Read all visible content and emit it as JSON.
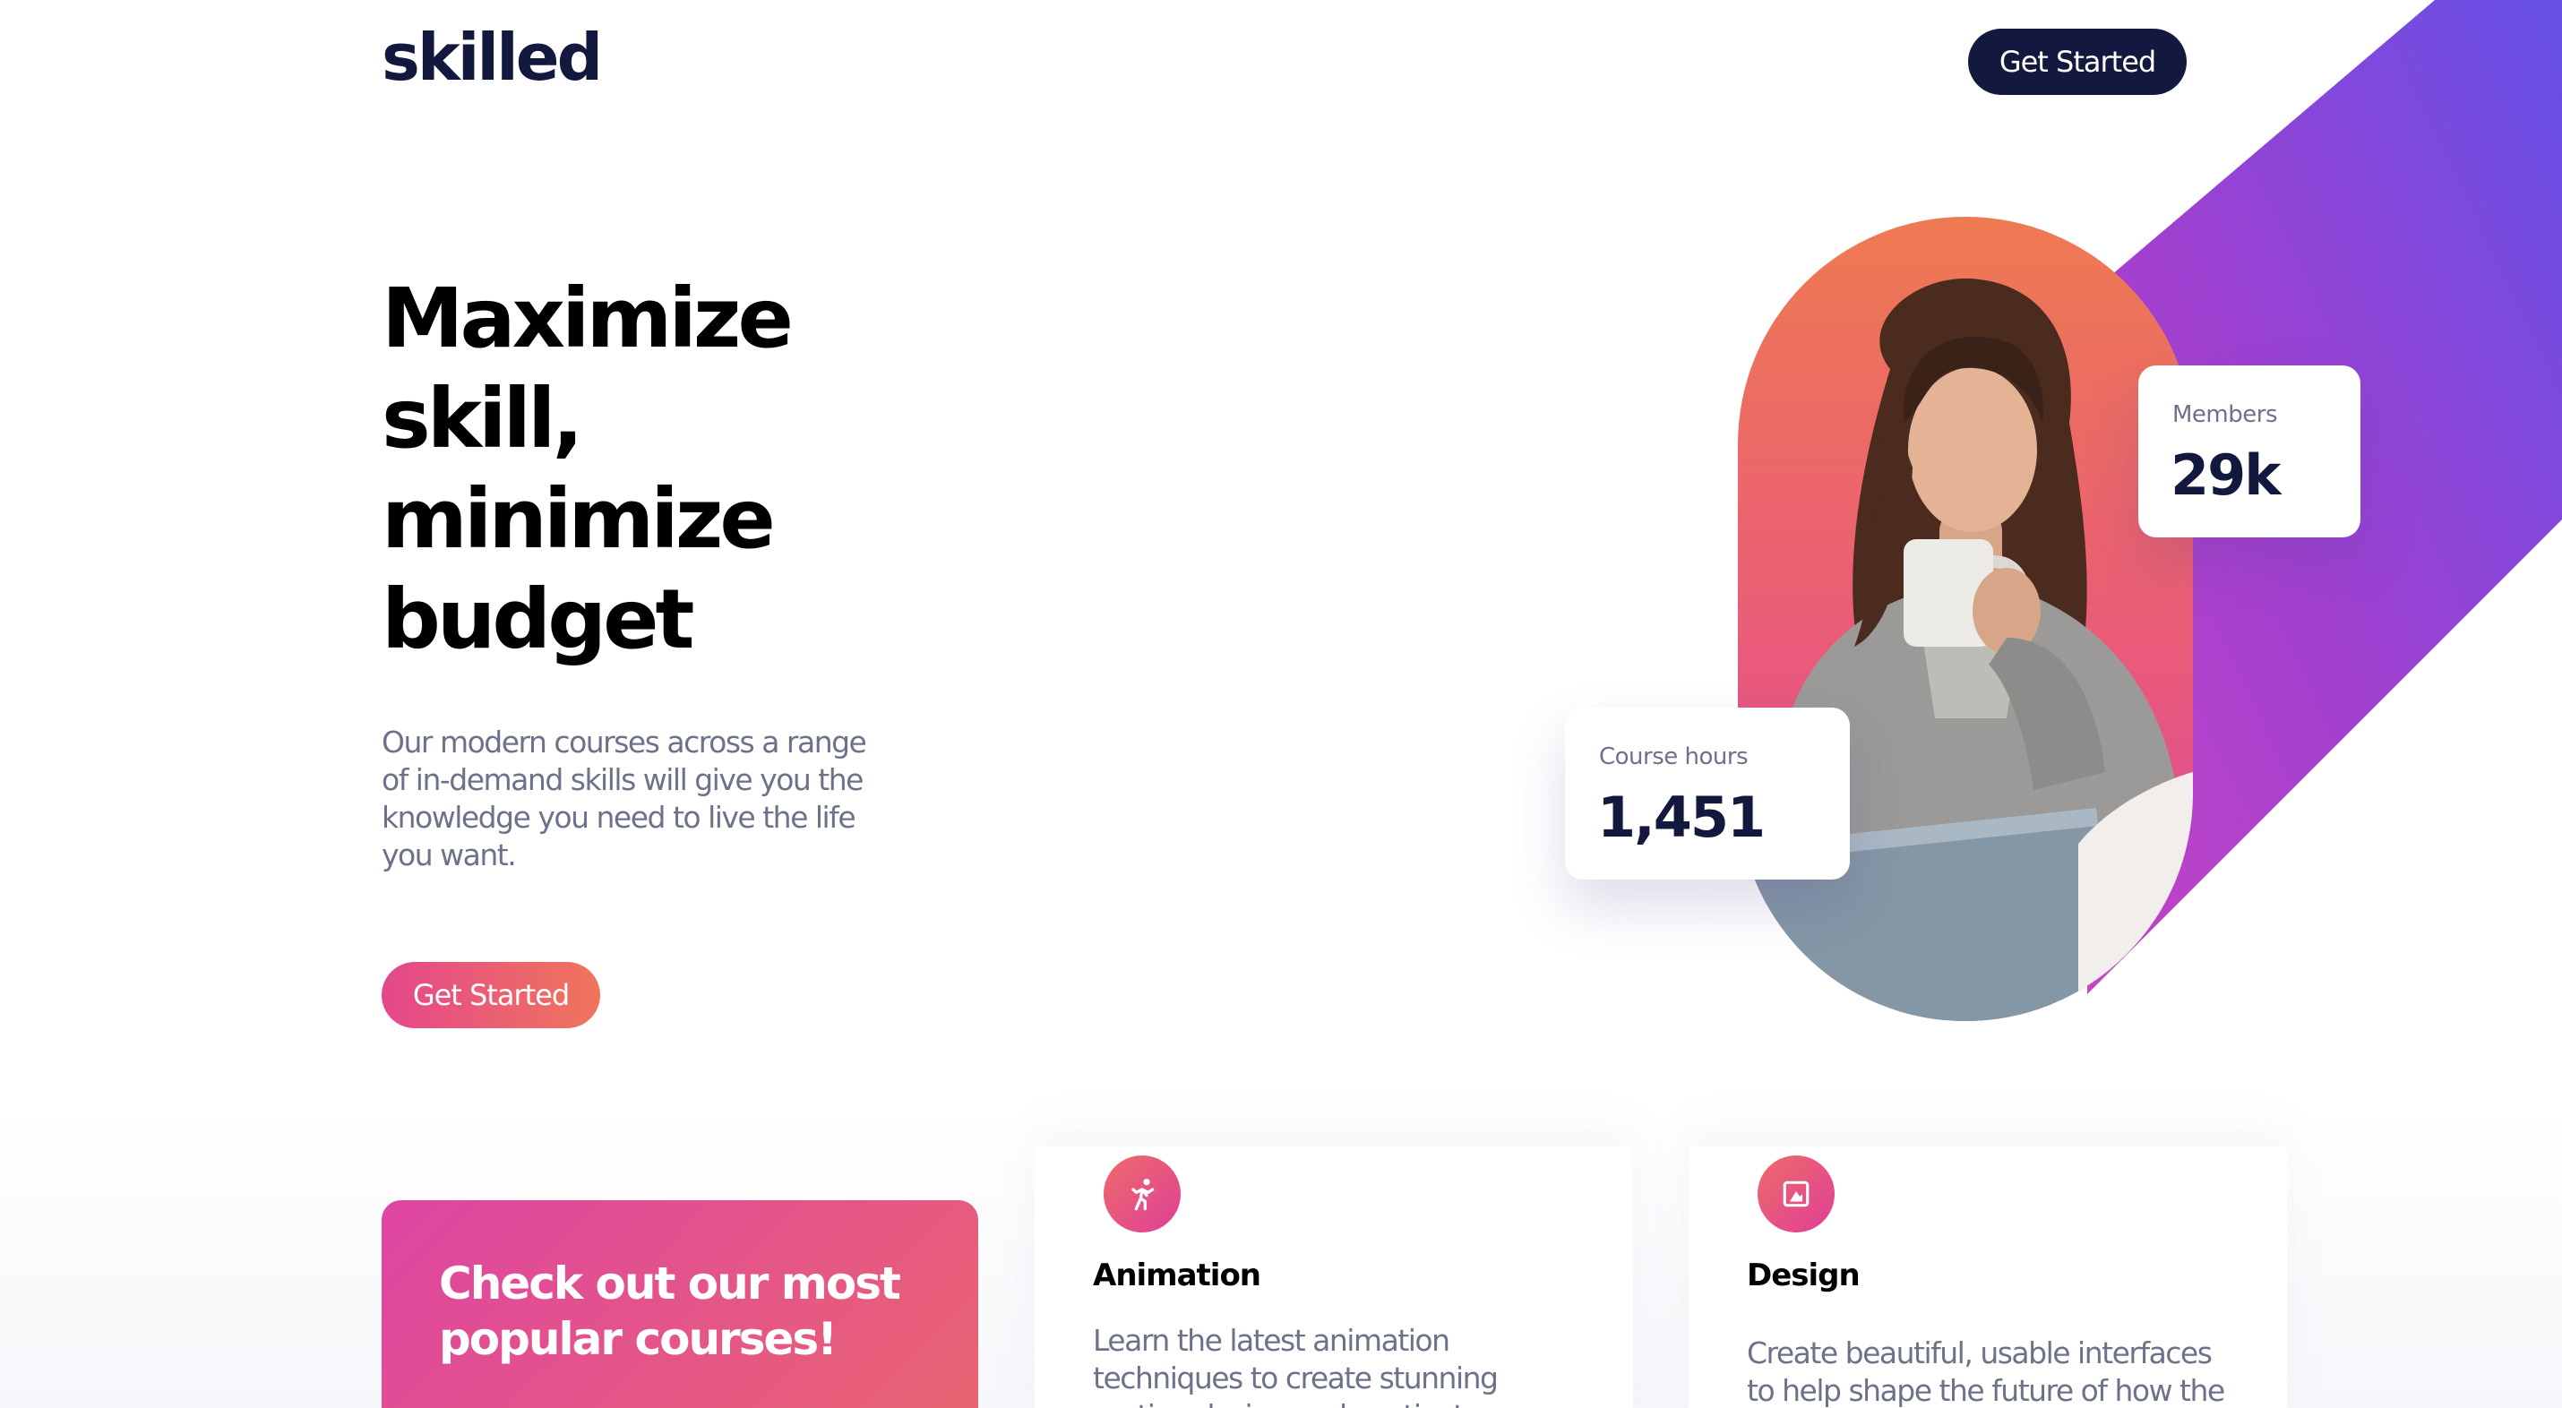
{
  "header": {
    "logo": "skilled",
    "cta_label": "Get Started"
  },
  "hero": {
    "title": "Maximize skill, minimize budget",
    "description": "Our modern courses across a range of in-demand skills will give you the knowledge you need to live the life you want.",
    "cta_label": "Get Started"
  },
  "stats": {
    "members": {
      "label": "Members",
      "value": "29k"
    },
    "course_hours": {
      "label": "Course hours",
      "value": "1,451"
    }
  },
  "promo": {
    "title": "Check out our most popular courses!"
  },
  "courses": [
    {
      "title": "Animation",
      "description": "Learn the latest animation techniques to create stunning motion design and captivate your audience.",
      "icon": "running-figure-icon"
    },
    {
      "title": "Design",
      "description": "Create beautiful, usable interfaces to help shape the future of how the web looks.",
      "icon": "image-frame-icon"
    }
  ],
  "colors": {
    "navy": "#13183f",
    "pink": "#e4478c",
    "orange": "#f0755c",
    "purple": "#6b4ce6"
  }
}
